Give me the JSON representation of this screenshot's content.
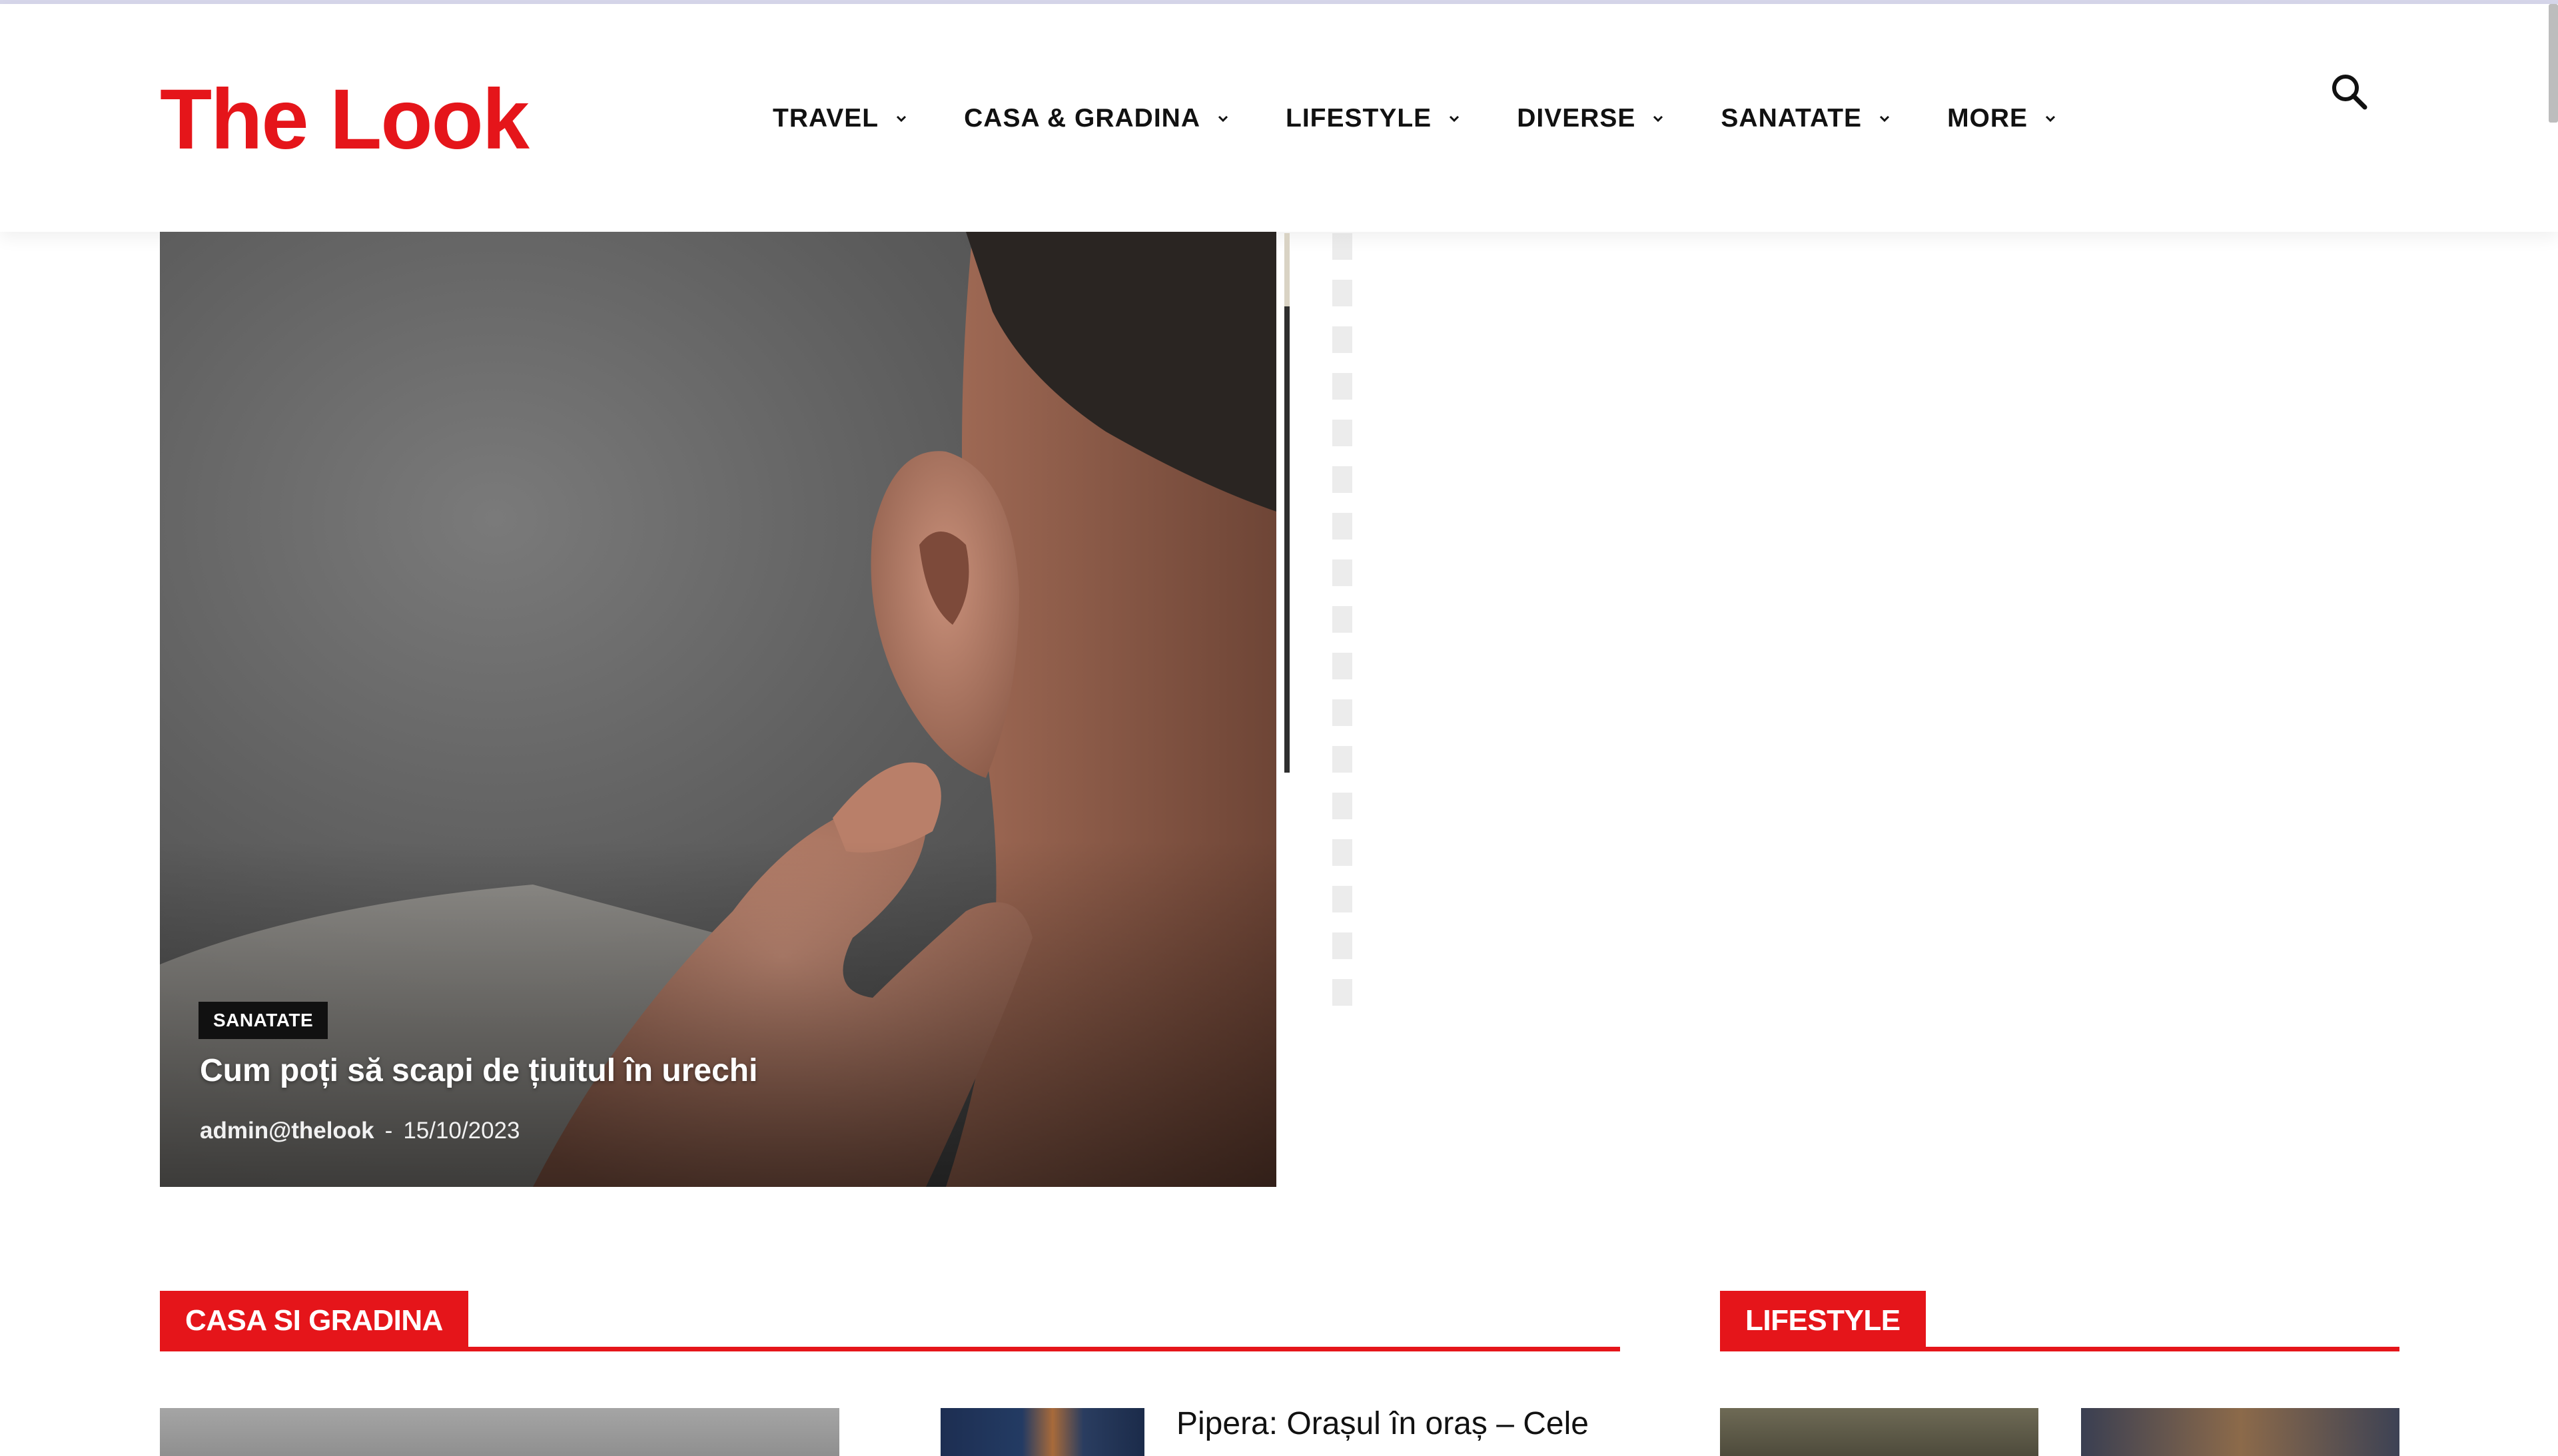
{
  "brand": {
    "logo_text": "The Look",
    "accent_color": "#e5151a"
  },
  "nav": {
    "items": [
      {
        "label": "TRAVEL"
      },
      {
        "label": "CASA & GRADINA"
      },
      {
        "label": "LIFESTYLE"
      },
      {
        "label": "DIVERSE"
      },
      {
        "label": "SANATATE"
      },
      {
        "label": "MORE"
      }
    ],
    "search_icon": "search-icon"
  },
  "hero": {
    "category": "SANATATE",
    "title": "Cum poți să scapi de țiuitul în urechi",
    "author": "admin@thelook",
    "separator": "-",
    "date": "15/10/2023"
  },
  "sections": {
    "casa": {
      "heading": "CASA SI GRADINA",
      "post_title": "Pipera: Orașul în oraș – Cele"
    },
    "lifestyle": {
      "heading": "LIFESTYLE"
    }
  }
}
